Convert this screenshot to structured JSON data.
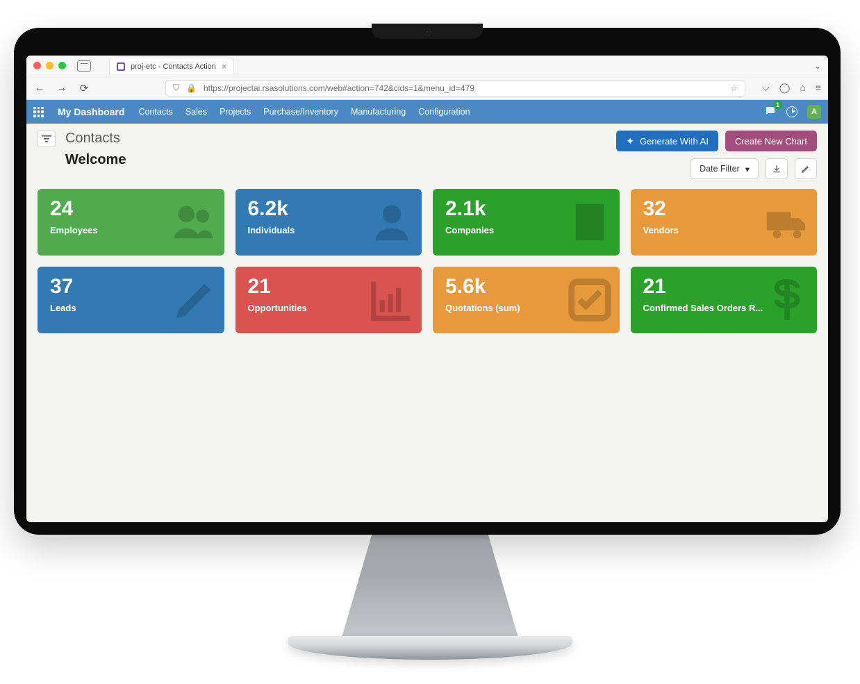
{
  "browser": {
    "tab_title": "proj-etc - Contacts Action",
    "url": "https://projectai.rsasolutions.com/web#action=742&cids=1&menu_id=479"
  },
  "top_nav": {
    "brand": "My Dashboard",
    "links": [
      "Contacts",
      "Sales",
      "Projects",
      "Purchase/Inventory",
      "Manufacturing",
      "Configuration"
    ],
    "chat_badge": "1",
    "avatar_initial": "A"
  },
  "header": {
    "page_title": "Contacts",
    "welcome": "Welcome",
    "generate_btn": "Generate With AI",
    "create_chart_btn": "Create New Chart",
    "date_filter_label": "Date Filter"
  },
  "cards": [
    {
      "value": "24",
      "label": "Employees",
      "color": "c-green",
      "icon": "users"
    },
    {
      "value": "6.2k",
      "label": "Individuals",
      "color": "c-blue",
      "icon": "person"
    },
    {
      "value": "2.1k",
      "label": "Companies",
      "color": "c-green2",
      "icon": "building"
    },
    {
      "value": "32",
      "label": "Vendors",
      "color": "c-orange",
      "icon": "truck"
    },
    {
      "value": "37",
      "label": "Leads",
      "color": "c-blue",
      "icon": "pencil"
    },
    {
      "value": "21",
      "label": "Opportunities",
      "color": "c-red",
      "icon": "barchart"
    },
    {
      "value": "5.6k",
      "label": "Quotations (sum)",
      "color": "c-orange",
      "icon": "check"
    },
    {
      "value": "21",
      "label": "Confirmed Sales Orders R...",
      "color": "c-green2",
      "icon": "dollar"
    }
  ]
}
